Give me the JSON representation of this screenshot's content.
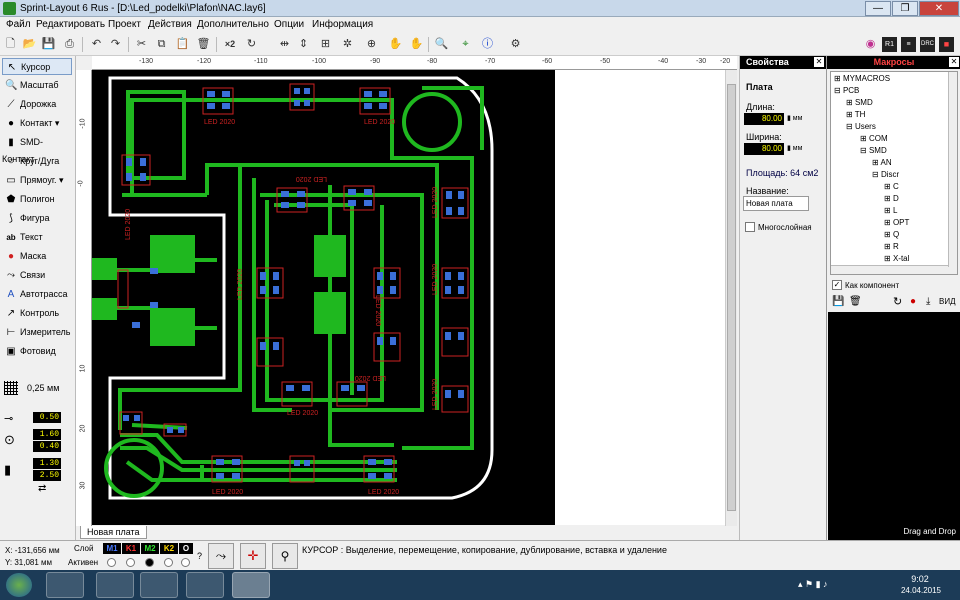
{
  "window": {
    "title": "Sprint-Layout 6 Rus - [D:\\Led_podelki\\Plafon\\NAC.lay6]",
    "minimize": "—",
    "maximize": "❐",
    "close": "✕"
  },
  "menu": [
    "Файл",
    "Редактировать",
    "Проект",
    "Действия",
    "Дополнительно",
    "Опции",
    "Информация"
  ],
  "toolbar": {
    "zoom_label": "×2"
  },
  "tools": [
    {
      "name": "kursor",
      "label": "Курсор",
      "icon": "cursor-icon"
    },
    {
      "name": "masshtab",
      "label": "Масштаб",
      "icon": "zoom-icon"
    },
    {
      "name": "dorozhka",
      "label": "Дорожка",
      "icon": "track-icon"
    },
    {
      "name": "kontakt",
      "label": "Контакт",
      "icon": "pad-icon"
    },
    {
      "name": "smd",
      "label": "SMD-Контакт",
      "icon": "smd-icon"
    },
    {
      "name": "krug",
      "label": "Круг/Дуга",
      "icon": "circle-icon"
    },
    {
      "name": "pryamoug",
      "label": "Прямоуг.",
      "icon": "rect-icon"
    },
    {
      "name": "poligon",
      "label": "Полигон",
      "icon": "polygon-icon"
    },
    {
      "name": "figura",
      "label": "Фигура",
      "icon": "shape-icon"
    },
    {
      "name": "tekst",
      "label": "Текст",
      "icon": "text-icon"
    },
    {
      "name": "maska",
      "label": "Маска",
      "icon": "mask-icon"
    },
    {
      "name": "svyazi",
      "label": "Связи",
      "icon": "connections-icon"
    },
    {
      "name": "avtotrassa",
      "label": "Автотрасса",
      "icon": "autoroute-icon"
    },
    {
      "name": "kontrol",
      "label": "Контроль",
      "icon": "check-icon"
    },
    {
      "name": "izmeritel",
      "label": "Измеритель",
      "icon": "measure-icon"
    },
    {
      "name": "fotovid",
      "label": "Фотовид",
      "icon": "photo-icon"
    }
  ],
  "grid": {
    "value": "0,25",
    "unit": "мм"
  },
  "params": {
    "track": "0.50",
    "pad_outer": "1.60",
    "pad_inner": "0.40",
    "smd_w": "1.30",
    "smd_h": "2.50"
  },
  "ruler": {
    "top": [
      "-130",
      "-120",
      "-110",
      "-100",
      "-90",
      "-80",
      "-70",
      "-60",
      "-50",
      "-40",
      "-30",
      "-20"
    ],
    "left": [
      "-10",
      "-0",
      "10",
      "20",
      "30"
    ]
  },
  "silk_label": "LED 2020",
  "tab": "Новая плата",
  "properties": {
    "header": "Свойства",
    "section": "Плата",
    "length_label": "Длина:",
    "length_value": "80.00",
    "width_label": "Ширина:",
    "width_value": "80.00",
    "unit": "мм",
    "area": "Площадь: 64 см2",
    "name_label": "Название:",
    "name_value": "Новая плата",
    "multilayer": "Многослойная"
  },
  "macros": {
    "header": "Макросы",
    "tree": [
      {
        "label": "MYMACROS",
        "level": 0,
        "sign": "+"
      },
      {
        "label": "PCB",
        "level": 0,
        "sign": "-"
      },
      {
        "label": "SMD",
        "level": 1,
        "sign": "+"
      },
      {
        "label": "TH",
        "level": 1,
        "sign": "+"
      },
      {
        "label": "Users",
        "level": 1,
        "sign": "-"
      },
      {
        "label": "COM",
        "level": 2,
        "sign": "+"
      },
      {
        "label": "SMD",
        "level": 2,
        "sign": "-"
      },
      {
        "label": "AN",
        "level": 3,
        "sign": "+"
      },
      {
        "label": "Discr",
        "level": 3,
        "sign": "-"
      },
      {
        "label": "C",
        "level": 4,
        "sign": "+"
      },
      {
        "label": "D",
        "level": 4,
        "sign": "+"
      },
      {
        "label": "L",
        "level": 4,
        "sign": "+"
      },
      {
        "label": "OPT",
        "level": 4,
        "sign": "+"
      },
      {
        "label": "Q",
        "level": 4,
        "sign": "+"
      },
      {
        "label": "R",
        "level": 4,
        "sign": "+"
      },
      {
        "label": "X-tal",
        "level": 4,
        "sign": "+"
      }
    ],
    "as_component": "Как компонент",
    "view": "ВИД",
    "drag_drop": "Drag and Drop"
  },
  "status": {
    "x": "X:  -131,656 мм",
    "y": "Y:   31,081 мм",
    "layer_label": "Слой",
    "active_label": "Активен",
    "layers": [
      {
        "label": "M1",
        "color": "#4a7aff"
      },
      {
        "label": "K1",
        "color": "#ff3030"
      },
      {
        "label": "M2",
        "color": "#30e030"
      },
      {
        "label": "K2",
        "color": "#ffd700"
      },
      {
        "label": "O",
        "color": "#ffffff"
      }
    ],
    "help": "?",
    "message": "КУРСОР  : Выделение, перемещение, копирование, дублирование, вставка и удаление"
  },
  "taskbar": {
    "time": "9:02",
    "date": "24.04.2015"
  },
  "colors": {
    "copper": "#1fb81f",
    "pad": "#3a6fd8",
    "silk": "#cc2222",
    "outline": "#ffffff"
  }
}
